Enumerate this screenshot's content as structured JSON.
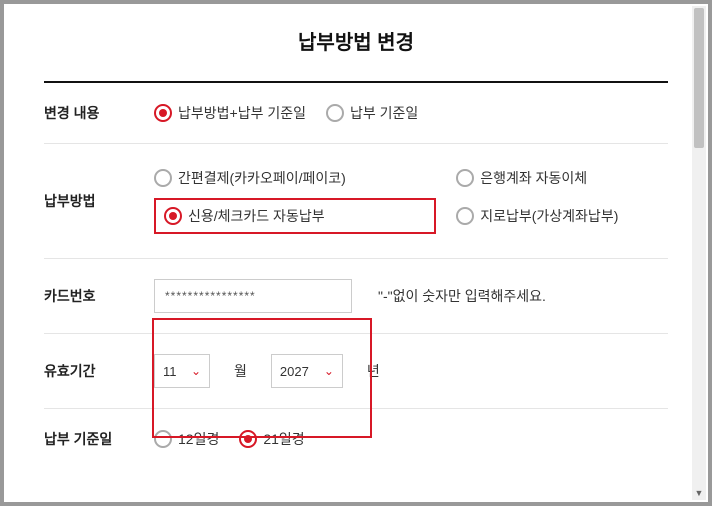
{
  "header": {
    "title": "납부방법 변경"
  },
  "rows": {
    "change_content": {
      "label": "변경 내용",
      "options": {
        "method_and_date": "납부방법+납부 기준일",
        "date_only": "납부 기준일"
      }
    },
    "payment_method": {
      "label": "납부방법",
      "options": {
        "simple": "간편결제(카카오페이/페이코)",
        "bank": "은행계좌 자동이체",
        "card": "신용/체크카드 자동납부",
        "giro": "지로납부(가상계좌납부)"
      }
    },
    "card_number": {
      "label": "카드번호",
      "value": "****************",
      "hint": "\"-\"없이 숫자만 입력해주세요."
    },
    "expiry": {
      "label": "유효기간",
      "month": "11",
      "month_unit": "월",
      "year": "2027",
      "year_unit": "년"
    },
    "due_date": {
      "label": "납부 기준일",
      "options": {
        "d12": "12일경",
        "d21": "21일경"
      }
    }
  }
}
